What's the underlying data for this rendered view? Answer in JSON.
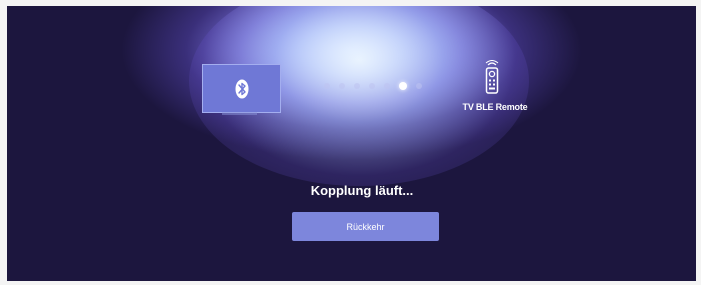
{
  "pairing": {
    "device_name": "TV BLE Remote",
    "status_text": "Kopplung läuft...",
    "back_button_label": "Rückkehr",
    "progress_dots": [
      false,
      false,
      false,
      false,
      false,
      true,
      false
    ]
  },
  "colors": {
    "background": "#1c163e",
    "accent": "#7d86dc",
    "glow": "#d9e8ff"
  },
  "icons": {
    "source": "bluetooth-icon",
    "target": "remote-control-icon"
  }
}
